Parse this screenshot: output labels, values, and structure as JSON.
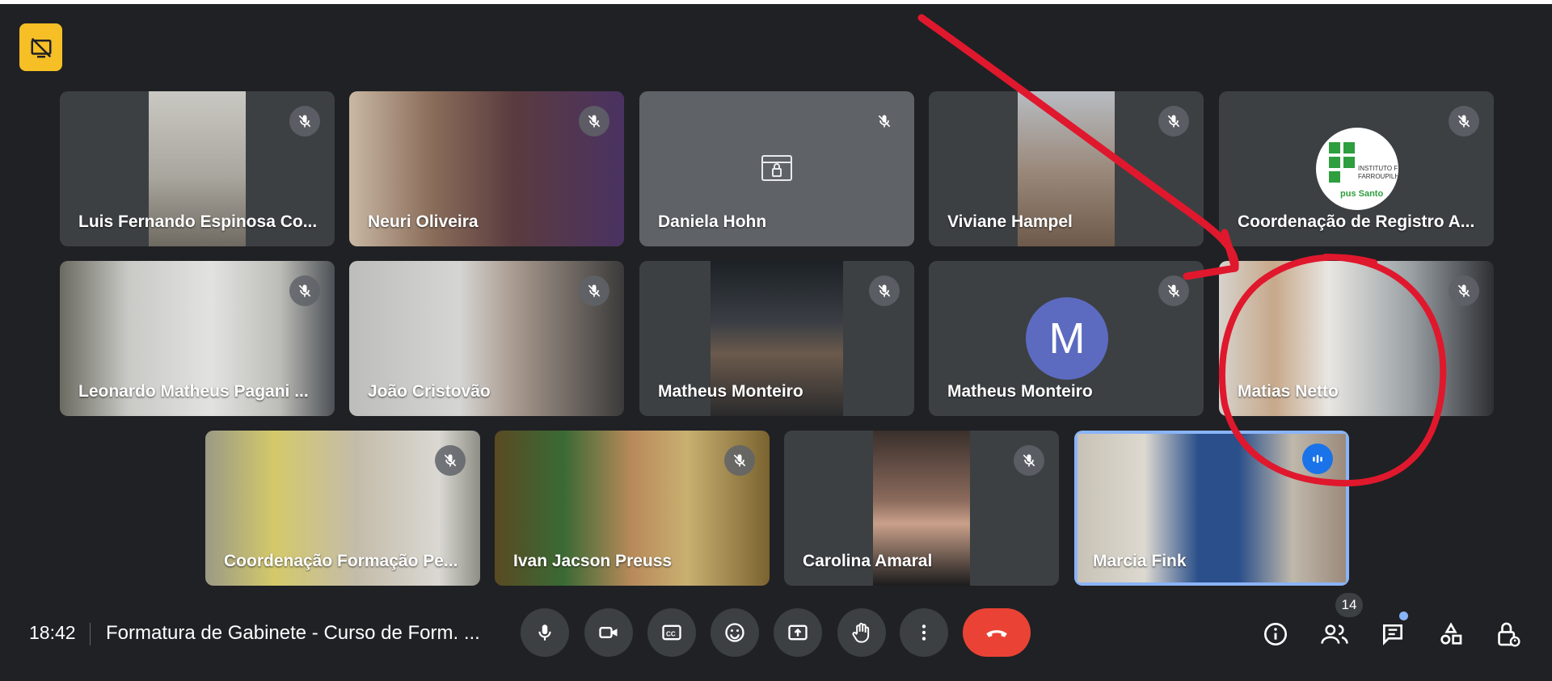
{
  "participants": [
    {
      "name": "Luis Fernando Espinosa Co...",
      "muted": true
    },
    {
      "name": "Neuri Oliveira",
      "muted": true
    },
    {
      "name": "Daniela Hohn",
      "muted": true
    },
    {
      "name": "Viviane Hampel",
      "muted": true
    },
    {
      "name": "Coordenação de Registro A...",
      "muted": true,
      "logo_text": "INSTITUTO F",
      "logo_text2": "FARROUPILH",
      "logo_text3": "pus Santo"
    },
    {
      "name": "Leonardo Matheus Pagani ...",
      "muted": true
    },
    {
      "name": "João Cristovão",
      "muted": true
    },
    {
      "name": "Matheus Monteiro",
      "muted": true
    },
    {
      "name": "Matheus Monteiro",
      "muted": true,
      "avatar_letter": "M"
    },
    {
      "name": "Matias Netto",
      "muted": true
    },
    {
      "name": "Coordenação Formação Pe...",
      "muted": true
    },
    {
      "name": "Ivan Jacson Preuss",
      "muted": true
    },
    {
      "name": "Carolina Amaral",
      "muted": true
    },
    {
      "name": "Marcia Fink",
      "muted": false,
      "speaking": true
    }
  ],
  "bottom_bar": {
    "time": "18:42",
    "meeting_title": "Formatura de Gabinete - Curso de Form. ...",
    "people_count": "14",
    "controls": [
      "mic-icon",
      "camera-icon",
      "captions-icon",
      "emoji-icon",
      "present-icon",
      "raise-hand-icon",
      "more-icon",
      "hangup-icon"
    ],
    "right_icons": [
      "info-icon",
      "people-icon",
      "chat-icon",
      "activities-icon",
      "host-controls-icon"
    ]
  },
  "colors": {
    "background": "#202124",
    "tile": "#3c4043",
    "hangup": "#ea4335",
    "accent": "#8ab4f8",
    "avatar": "#5c6bc0",
    "badge": "#f6bf26",
    "annotation": "#e0182d"
  }
}
